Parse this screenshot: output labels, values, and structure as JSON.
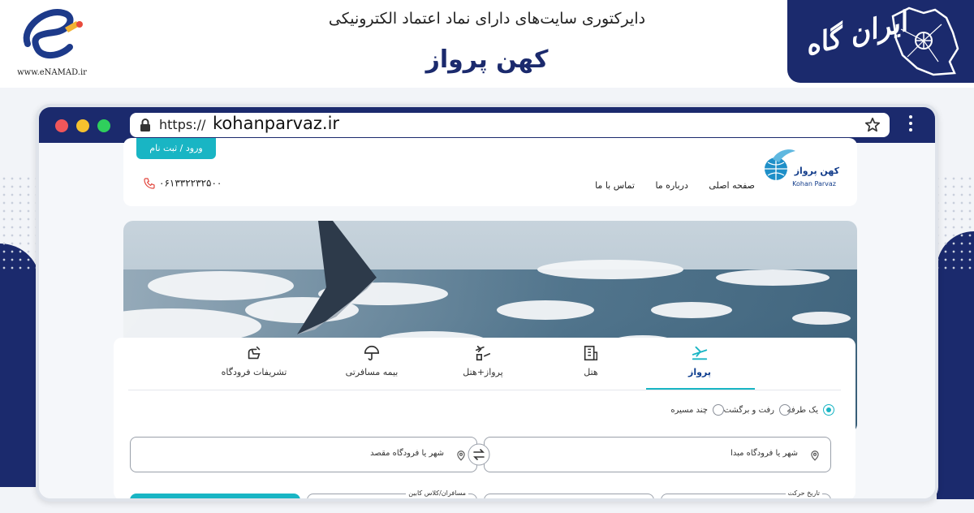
{
  "banner": {
    "directory_title": "دایرکتوری سایت‌های دارای نماد اعتماد الکترونیکی",
    "site_name": "کهن پرواز",
    "enamad_url": "www.eNAMAD.ir",
    "iran_badge_text": "ایران گاه"
  },
  "browser": {
    "url_prefix": "https://",
    "url_domain": "kohanparvaz.ir",
    "traffic_colors": [
      "#f0565a",
      "#f5c12e",
      "#2fcf5c"
    ]
  },
  "site": {
    "login_button": "ورود / ثبت نام",
    "phone": "۰۶۱۳۳۲۲۳۲۵۰۰",
    "nav": [
      "صفحه اصلی",
      "درباره ما",
      "تماس با ما"
    ],
    "logo_fa": "کهن پرواز",
    "logo_en": "Kohan Parvaz"
  },
  "search": {
    "tabs": [
      {
        "label": "پرواز",
        "icon": "flight-icon",
        "active": true
      },
      {
        "label": "هتل",
        "icon": "hotel-icon",
        "active": false
      },
      {
        "label": "پرواز+هتل",
        "icon": "flight-hotel-icon",
        "active": false
      },
      {
        "label": "بیمه مسافرتی",
        "icon": "umbrella-icon",
        "active": false
      },
      {
        "label": "تشریفات فرودگاه",
        "icon": "airport-service-icon",
        "active": false
      }
    ],
    "trip_types": [
      {
        "label": "یک طرفه",
        "selected": true
      },
      {
        "label": "رفت و برگشت",
        "selected": false
      },
      {
        "label": "چند مسیره",
        "selected": false
      }
    ],
    "origin_placeholder": "شهر یا فرودگاه مبدا",
    "destination_placeholder": "شهر یا فرودگاه مقصد",
    "date_label": "تاریخ حرکت",
    "passengers_label": "مسافران/کلاس کابین"
  },
  "colors": {
    "brand_navy": "#1b2a6d",
    "accent_teal": "#19b5c4"
  }
}
